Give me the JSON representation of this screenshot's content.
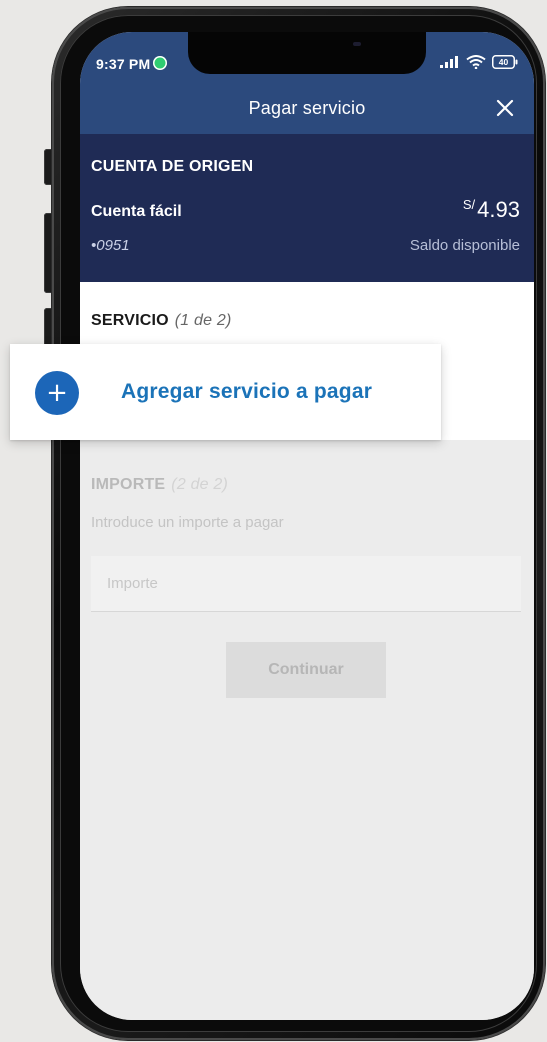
{
  "status_bar": {
    "time": "9:37 PM",
    "battery": "40"
  },
  "header": {
    "title": "Pagar servicio",
    "close_icon": "close-icon"
  },
  "account": {
    "section_title": "CUENTA DE ORIGEN",
    "name": "Cuenta fácil",
    "number": "•0951",
    "currency": "S/",
    "balance": "4.93",
    "balance_label": "Saldo disponible"
  },
  "service": {
    "title": "SERVICIO",
    "step": "(1 de 2)",
    "add_label": "Agregar servicio a pagar",
    "add_icon": "+"
  },
  "importe": {
    "title": "IMPORTE",
    "step": "(2 de 2)",
    "help": "Introduce un importe a pagar",
    "placeholder": "Importe",
    "continue_label": "Continuar"
  },
  "colors": {
    "header_bg": "#2c4a7d",
    "account_bg": "#1f2b55",
    "accent_blue": "#1b73b8",
    "add_icon_bg": "#1c66b8",
    "page_bg": "#e9e8e6"
  }
}
